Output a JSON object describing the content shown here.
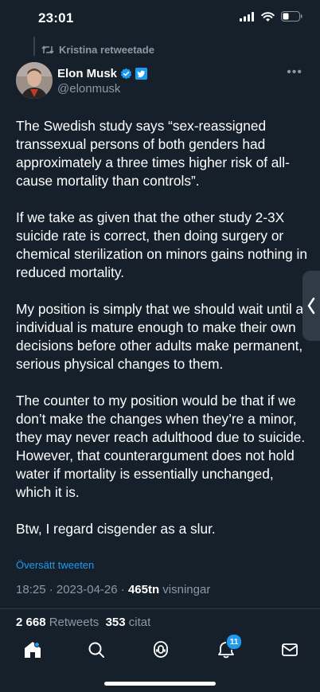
{
  "status_bar": {
    "time": "23:01"
  },
  "retweet": {
    "label": "Kristina retweetade"
  },
  "author": {
    "name": "Elon Musk",
    "handle": "@elonmusk"
  },
  "tweet": {
    "paragraphs": [
      "The Swedish study says “sex-reassigned transsexual persons of both genders had approximately a three times higher risk of all-cause mortality than controls”.",
      "If we take as given that the other study 2-3X suicide rate is correct, then doing surgery or chemical sterilization on minors gains nothing in reduced mortality.",
      "My position is simply that we should wait until an individual is mature enough to make their own decisions before other adults make permanent, serious physical changes to them.",
      "The counter to my position would be that if we don’t make the changes when they’re a minor, they may never reach adulthood due to suicide. However, that counterargument does not hold water if mortality is essentially unchanged, which it is.",
      "Btw, I regard cisgender as a slur."
    ],
    "translate": "Översätt tweeten",
    "timestamp": "18:25 · 2023-04-26 · ",
    "views_count": "465tn",
    "views_label": " visningar"
  },
  "stats": {
    "retweets_count": "2 668",
    "retweets_label": " Retweets  ",
    "quotes_count": "353",
    "quotes_label": " citat"
  },
  "nav": {
    "notifications_badge": "11"
  },
  "colors": {
    "background": "#15202b",
    "accent": "#1d9bf0",
    "muted": "#8b98a5"
  }
}
